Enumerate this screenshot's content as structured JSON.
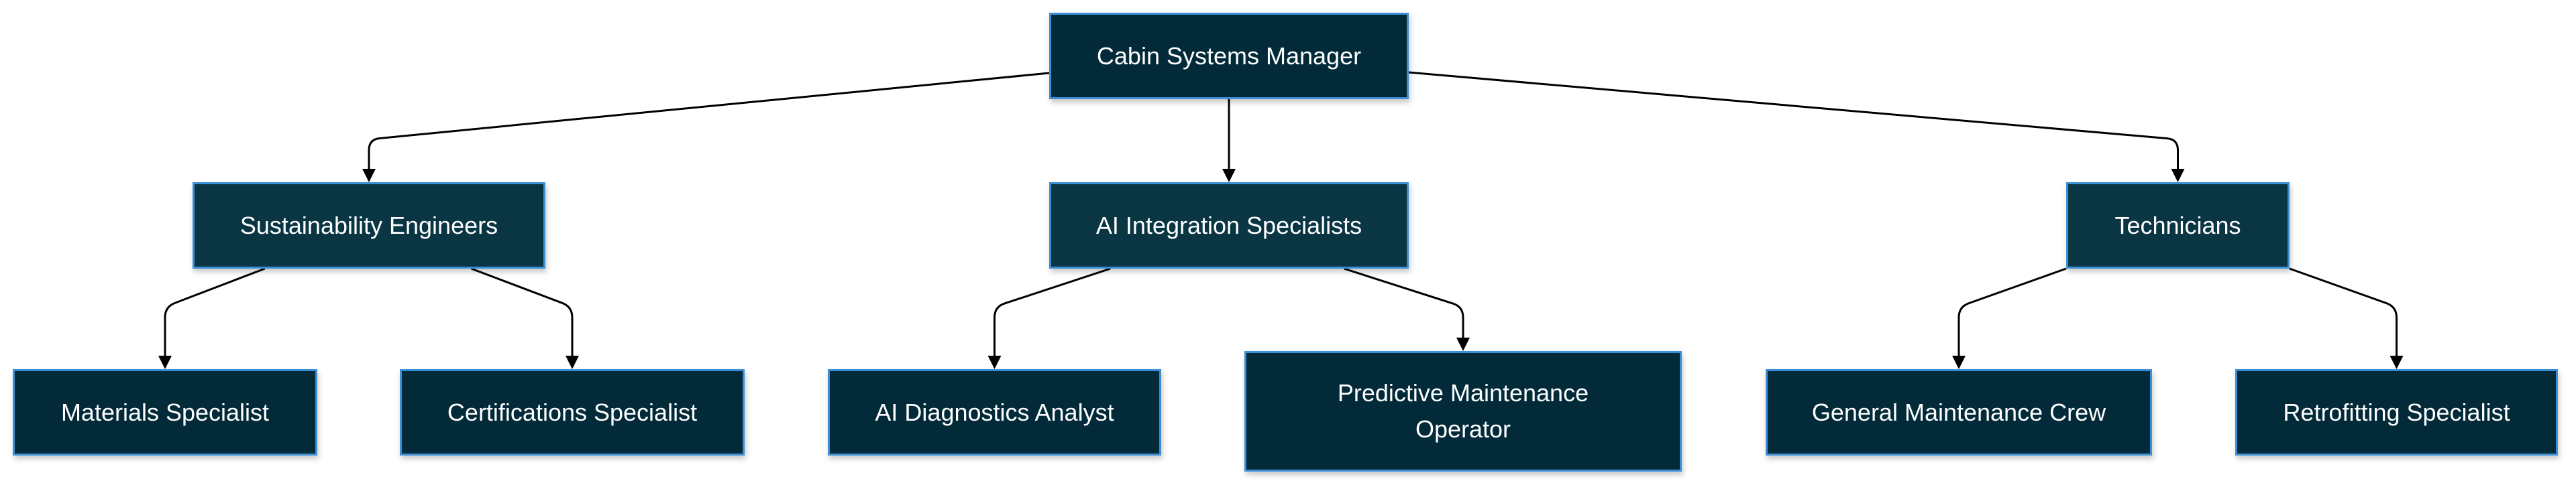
{
  "diagram": {
    "type": "org-chart",
    "colors": {
      "root_fill": "#022a39",
      "mid_fill": "#0a3644",
      "leaf_fill": "#022a39",
      "border": "#3b8fd6",
      "text": "#ffffff",
      "edge": "#000000"
    },
    "nodes": {
      "root": {
        "label": "Cabin Systems Manager"
      },
      "sust": {
        "label": "Sustainability Engineers"
      },
      "ai": {
        "label": "AI Integration Specialists"
      },
      "tech": {
        "label": "Technicians"
      },
      "mat": {
        "label": "Materials Specialist"
      },
      "cert": {
        "label": "Certifications Specialist"
      },
      "diag": {
        "label": "AI Diagnostics Analyst"
      },
      "pred": {
        "label": "Predictive Maintenance Operator"
      },
      "gen": {
        "label": "General Maintenance Crew"
      },
      "retro": {
        "label": "Retrofitting Specialist"
      }
    },
    "edges": [
      {
        "from": "root",
        "to": "sust"
      },
      {
        "from": "root",
        "to": "ai"
      },
      {
        "from": "root",
        "to": "tech"
      },
      {
        "from": "sust",
        "to": "mat"
      },
      {
        "from": "sust",
        "to": "cert"
      },
      {
        "from": "ai",
        "to": "diag"
      },
      {
        "from": "ai",
        "to": "pred"
      },
      {
        "from": "tech",
        "to": "gen"
      },
      {
        "from": "tech",
        "to": "retro"
      }
    ]
  }
}
